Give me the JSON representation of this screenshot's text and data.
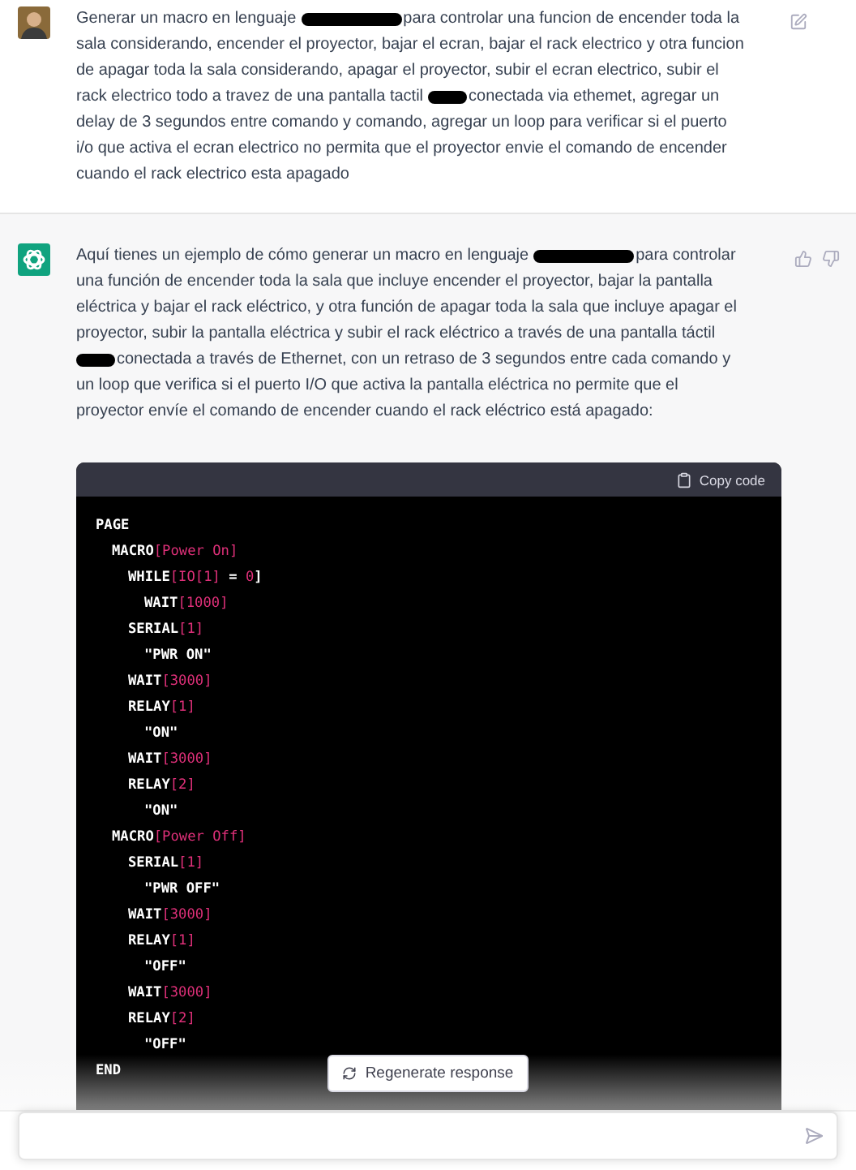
{
  "user_message": {
    "lines": [
      [
        {
          "kind": "text",
          "text": "Generar un macro en lenguaje"
        },
        {
          "kind": "redacted_long"
        },
        {
          "kind": "text",
          "text": "para controlar una funcion de encender toda la"
        }
      ],
      [
        {
          "kind": "text",
          "text": "sala considerando, encender el proyector, bajar el ecran, bajar el rack electrico y otra funcion"
        }
      ],
      [
        {
          "kind": "text",
          "text": "de apagar toda la sala considerando, apagar el proyector, subir el ecran electrico, subir el"
        }
      ],
      [
        {
          "kind": "text",
          "text": "rack electrico todo a travez de una pantalla tactil"
        },
        {
          "kind": "redacted_short"
        },
        {
          "kind": "text",
          "text": "conectada via ethemet, agregar un"
        }
      ],
      [
        {
          "kind": "text",
          "text": "delay de 3 segundos entre comando y comando, agregar un loop para verificar si el puerto"
        }
      ],
      [
        {
          "kind": "text",
          "text": "i/o que activa el ecran electrico no permita que el proyector envie el comando de encender"
        }
      ],
      [
        {
          "kind": "text",
          "text": "cuando el rack electrico esta apagado"
        }
      ]
    ]
  },
  "assistant_message": {
    "lines": [
      [
        {
          "kind": "text",
          "text": "Aquí tienes un ejemplo de cómo generar un macro en lenguaje"
        },
        {
          "kind": "redacted_long"
        },
        {
          "kind": "text",
          "text": "para controlar"
        }
      ],
      [
        {
          "kind": "text",
          "text": "una función de encender toda la sala que incluye encender el proyector, bajar la pantalla"
        }
      ],
      [
        {
          "kind": "text",
          "text": "eléctrica y bajar el rack eléctrico, y otra función de apagar toda la sala que incluye apagar el"
        }
      ],
      [
        {
          "kind": "text",
          "text": "proyector, subir la pantalla eléctrica y subir el rack eléctrico a través de una pantalla táctil"
        }
      ],
      [
        {
          "kind": "redacted_short"
        },
        {
          "kind": "text",
          "text": "conectada a través de Ethernet, con un retraso de 3 segundos entre cada comando y"
        }
      ],
      [
        {
          "kind": "text",
          "text": "un loop que verifica si el puerto I/O que activa la pantalla eléctrica no permite que el"
        }
      ],
      [
        {
          "kind": "text",
          "text": "proyector envíe el comando de encender cuando el rack eléctrico está apagado:"
        }
      ]
    ],
    "code_block": {
      "copy_label": "Copy code",
      "lines": [
        {
          "parts": [
            {
              "kind": "keyword",
              "text": "PAGE"
            }
          ],
          "children": [
            {
              "parts": [
                {
                  "kind": "keyword",
                  "text": "MACRO"
                },
                {
                  "kind": "argument",
                  "text": "[Power On]"
                }
              ],
              "children": [
                {
                  "parts": [
                    {
                      "kind": "keyword",
                      "text": "WHILE"
                    },
                    {
                      "kind": "argument",
                      "text": "[IO[1]"
                    },
                    {
                      "kind": "keyword",
                      "text": " = "
                    },
                    {
                      "kind": "argument",
                      "text": "0"
                    },
                    {
                      "kind": "keyword",
                      "text": "]"
                    }
                  ],
                  "children": [
                    {
                      "parts": [
                        {
                          "kind": "keyword",
                          "text": "WAIT"
                        },
                        {
                          "kind": "argument",
                          "text": "[1000]"
                        }
                      ]
                    }
                  ]
                },
                {
                  "parts": [
                    {
                      "kind": "keyword",
                      "text": "SERIAL"
                    },
                    {
                      "kind": "argument",
                      "text": "[1]"
                    }
                  ],
                  "children": [
                    {
                      "parts": [
                        {
                          "kind": "keyword",
                          "text": "\"PWR ON\""
                        }
                      ]
                    }
                  ]
                },
                {
                  "parts": [
                    {
                      "kind": "keyword",
                      "text": "WAIT"
                    },
                    {
                      "kind": "argument",
                      "text": "[3000]"
                    }
                  ]
                },
                {
                  "parts": [
                    {
                      "kind": "keyword",
                      "text": "RELAY"
                    },
                    {
                      "kind": "argument",
                      "text": "[1]"
                    }
                  ],
                  "children": [
                    {
                      "parts": [
                        {
                          "kind": "keyword",
                          "text": "\"ON\""
                        }
                      ]
                    }
                  ]
                },
                {
                  "parts": [
                    {
                      "kind": "keyword",
                      "text": "WAIT"
                    },
                    {
                      "kind": "argument",
                      "text": "[3000]"
                    }
                  ]
                },
                {
                  "parts": [
                    {
                      "kind": "keyword",
                      "text": "RELAY"
                    },
                    {
                      "kind": "argument",
                      "text": "[2]"
                    }
                  ],
                  "children": [
                    {
                      "parts": [
                        {
                          "kind": "keyword",
                          "text": "\"ON\""
                        }
                      ]
                    }
                  ]
                }
              ]
            },
            {
              "parts": [
                {
                  "kind": "keyword",
                  "text": "MACRO"
                },
                {
                  "kind": "argument",
                  "text": "[Power Off]"
                }
              ],
              "children": [
                {
                  "parts": [
                    {
                      "kind": "keyword",
                      "text": "SERIAL"
                    },
                    {
                      "kind": "argument",
                      "text": "[1]"
                    }
                  ],
                  "children": [
                    {
                      "parts": [
                        {
                          "kind": "keyword",
                          "text": "\"PWR OFF\""
                        }
                      ]
                    }
                  ]
                },
                {
                  "parts": [
                    {
                      "kind": "keyword",
                      "text": "WAIT"
                    },
                    {
                      "kind": "argument",
                      "text": "[3000]"
                    }
                  ]
                },
                {
                  "parts": [
                    {
                      "kind": "keyword",
                      "text": "RELAY"
                    },
                    {
                      "kind": "argument",
                      "text": "[1]"
                    }
                  ],
                  "children": [
                    {
                      "parts": [
                        {
                          "kind": "keyword",
                          "text": "\"OFF\""
                        }
                      ]
                    }
                  ]
                },
                {
                  "parts": [
                    {
                      "kind": "keyword",
                      "text": "WAIT"
                    },
                    {
                      "kind": "argument",
                      "text": "[3000]"
                    }
                  ]
                },
                {
                  "parts": [
                    {
                      "kind": "keyword",
                      "text": "RELAY"
                    },
                    {
                      "kind": "argument",
                      "text": "[2]"
                    }
                  ],
                  "children": [
                    {
                      "parts": [
                        {
                          "kind": "keyword",
                          "text": "\"OFF\""
                        }
                      ]
                    }
                  ]
                }
              ]
            }
          ]
        },
        {
          "parts": [
            {
              "kind": "keyword",
              "text": "END"
            }
          ]
        }
      ]
    }
  },
  "regenerate_button": "Regenerate response"
}
